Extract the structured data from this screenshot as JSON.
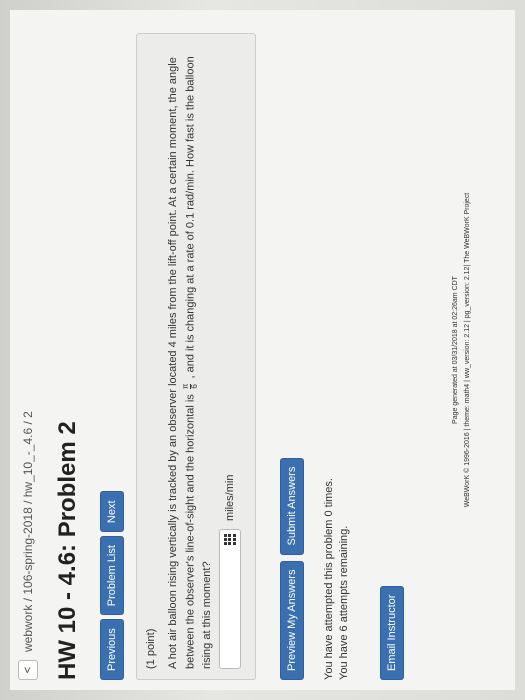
{
  "breadcrumb": {
    "back_glyph": "<",
    "path": "webwork / 106-spring-2018 / hw_10_-_4.6 / 2"
  },
  "title": "HW 10 - 4.6: Problem 2",
  "nav": {
    "previous": "Previous",
    "problem_list": "Problem List",
    "next": "Next"
  },
  "problem": {
    "points": "(1 point)",
    "statement_part1": "A hot air balloon rising vertically is tracked by an observer located 4 miles from the lift-off point. At a certain moment, the angle between the observer's line-of-sight and the horizontal is",
    "frac_num": "π",
    "frac_den": "6",
    "statement_part2": ", and it is changing at a rate of 0.1 rad/min. How fast is the balloon rising at this moment?",
    "answer_value": "",
    "units": "miles/min"
  },
  "actions": {
    "preview": "Preview My Answers",
    "submit": "Submit Answers"
  },
  "status": {
    "attempted": "You have attempted this problem 0 times.",
    "remaining": "You have 6 attempts remaining."
  },
  "email_instructor": "Email Instructor",
  "footer": {
    "generated": "Page generated at 03/31/2018 at 02:26am CDT",
    "credits": "WeBWorK © 1996-2016 | theme: math4 | ww_version: 2.12 | pg_version: 2.12| The WeBWorK Project"
  },
  "colors": {
    "button_blue": "#3a6fb0"
  },
  "icons": [
    "back-chevron-icon",
    "grid-keypad-icon"
  ]
}
